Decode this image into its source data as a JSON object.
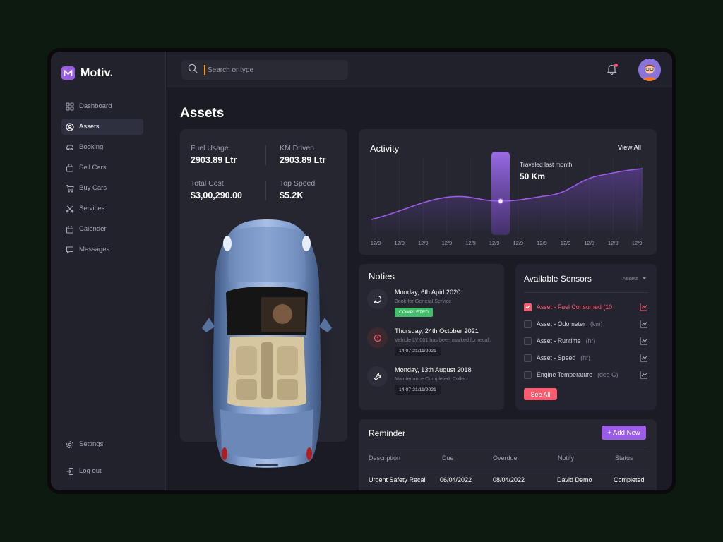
{
  "app": {
    "name": "Motiv."
  },
  "sidebar": {
    "items": [
      {
        "label": "Dashboard",
        "icon": "grid-icon"
      },
      {
        "label": "Assets",
        "icon": "user-circle-icon",
        "active": true
      },
      {
        "label": "Booking",
        "icon": "car-icon"
      },
      {
        "label": "Sell Cars",
        "icon": "bag-icon"
      },
      {
        "label": "Buy Cars",
        "icon": "cart-icon"
      },
      {
        "label": "Services",
        "icon": "tools-icon"
      },
      {
        "label": "Calender",
        "icon": "calendar-icon"
      },
      {
        "label": "Messages",
        "icon": "chat-icon"
      }
    ],
    "settings": "Settings",
    "logout": "Log out"
  },
  "topbar": {
    "search_placeholder": "Search or type"
  },
  "page": {
    "title": "Assets"
  },
  "stats": {
    "fuel_label": "Fuel Usage",
    "fuel_value": "2903.89 Ltr",
    "km_label": "KM Driven",
    "km_value": "2903.89 Ltr",
    "cost_label": "Total Cost",
    "cost_value": "$3,00,290.00",
    "speed_label": "Top Speed",
    "speed_value": "$5.2K"
  },
  "activity": {
    "title": "Activity",
    "view_all": "View All",
    "tooltip_label": "Traveled last month",
    "tooltip_value": "50 Km",
    "x_labels": [
      "12/9",
      "12/9",
      "12/9",
      "12/9",
      "12/9",
      "12/9",
      "12/9",
      "12/9",
      "12/9",
      "12/9",
      "12/9",
      "12/9"
    ],
    "line_color": "#9b5de5"
  },
  "notes": {
    "title": "Noties",
    "items": [
      {
        "date": "Monday, 6th Apirl 2020",
        "desc": "Book for General Service",
        "badge": "COMPLETED",
        "icon": "chat-bubble-icon"
      },
      {
        "date": "Thursday, 24th October 2021",
        "desc": "Vehicle LV 001 has been marked for recall.",
        "badge": "14:07-21/11/2021",
        "icon": "alert-icon"
      },
      {
        "date": "Monday, 13th August 2018",
        "desc": "Maintenance Completed, Collect",
        "badge": "14:07-21/11/2021",
        "icon": "wrench-icon"
      }
    ]
  },
  "sensors": {
    "title": "Available Sensors",
    "filter": "Assets",
    "items": [
      {
        "label": "Asset - Fuel Consumed (10",
        "unit": "",
        "checked": true
      },
      {
        "label": "Asset - Odometer",
        "unit": "(km)",
        "checked": false
      },
      {
        "label": "Asset - Runtime",
        "unit": "(hr)",
        "checked": false
      },
      {
        "label": "Asset - Speed",
        "unit": "(hr)",
        "checked": false
      },
      {
        "label": "Engine Temperature",
        "unit": "(deg C)",
        "checked": false
      }
    ],
    "see_all": "See All"
  },
  "reminder": {
    "title": "Reminder",
    "add_new": "+ Add New",
    "columns": [
      "Description",
      "Due",
      "Overdue",
      "Notify",
      "Status"
    ],
    "rows": [
      {
        "description": "Urgent Safety Recall",
        "due": "06/04/2022",
        "overdue": "08/04/2022",
        "notify": "David Demo",
        "status": "Completed"
      }
    ]
  },
  "colors": {
    "accent": "#9b5de5",
    "danger": "#ff5b6e",
    "success": "#3fbf6a",
    "warning": "#ff9800"
  }
}
